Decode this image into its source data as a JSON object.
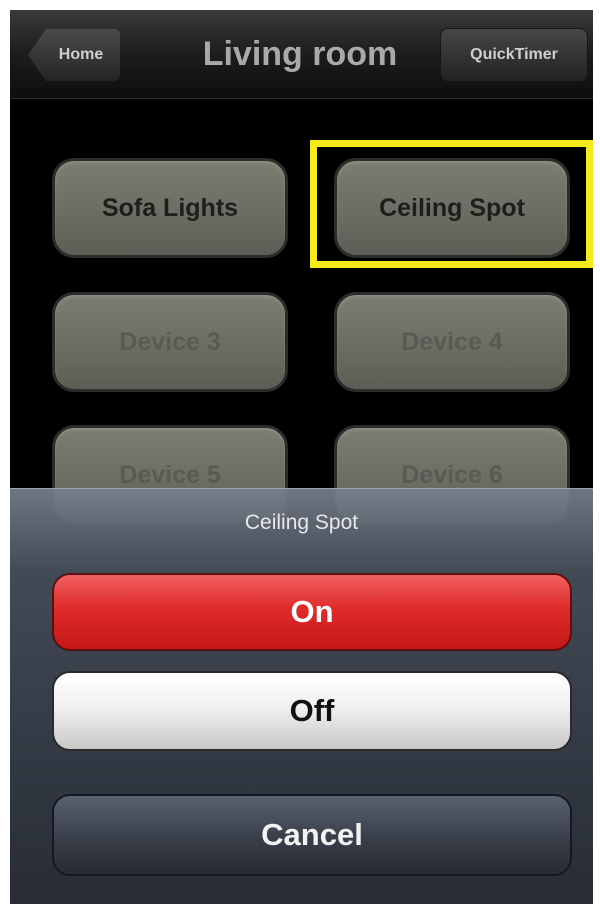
{
  "navbar": {
    "back_label": "Home",
    "title": "Living room",
    "quicktimer_label": "QuickTimer"
  },
  "devices": [
    {
      "label": "Sofa Lights",
      "enabled": true
    },
    {
      "label": "Ceiling Spot",
      "enabled": true,
      "highlighted": true
    },
    {
      "label": "Device 3",
      "enabled": false
    },
    {
      "label": "Device 4",
      "enabled": false
    },
    {
      "label": "Device 5",
      "enabled": false
    },
    {
      "label": "Device 6",
      "enabled": false
    }
  ],
  "action_sheet": {
    "title": "Ceiling Spot",
    "on_label": "On",
    "off_label": "Off",
    "cancel_label": "Cancel"
  },
  "colors": {
    "highlight": "#f5ea1a",
    "on_button": "#e02a2a",
    "device_button": "#6b6b62"
  }
}
